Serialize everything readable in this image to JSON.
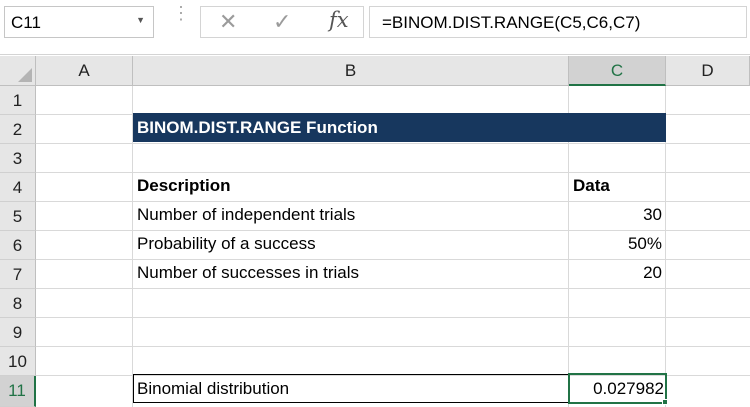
{
  "name_box": {
    "value": "C11"
  },
  "formula_bar": {
    "fx_label": "fx",
    "formula": "=BINOM.DIST.RANGE(C5,C6,C7)"
  },
  "columns": [
    "A",
    "B",
    "C",
    "D"
  ],
  "selected_column": "C",
  "rows": [
    "1",
    "2",
    "3",
    "4",
    "5",
    "6",
    "7",
    "8",
    "9",
    "10",
    "11"
  ],
  "selected_row": "11",
  "sheet": {
    "title": "BINOM.DIST.RANGE  Function",
    "header_description": "Description",
    "header_data": "Data",
    "items": [
      {
        "label": "Number of independent trials",
        "value": "30"
      },
      {
        "label": "Probability of a success",
        "value": "50%"
      },
      {
        "label": "Number of successes in trials",
        "value": "20"
      }
    ],
    "result_label": "Binomial distribution",
    "result_value": "0.027982"
  },
  "colors": {
    "title_fill": "#17375e",
    "selection": "#217346"
  }
}
